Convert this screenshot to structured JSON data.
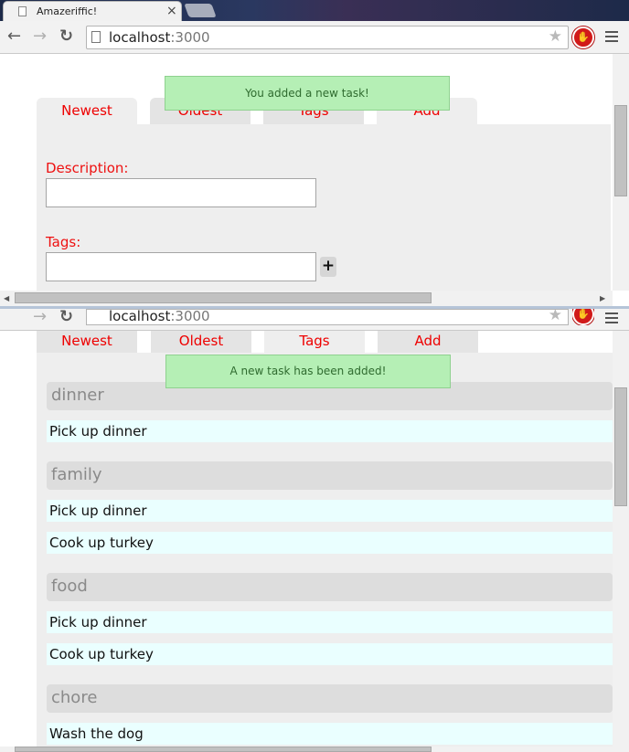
{
  "browser": {
    "tab_title": "Amazeriffic!",
    "tab_close": "×",
    "url_host": "localhost",
    "url_port": ":3000",
    "back_icon": "←",
    "forward_icon": "→",
    "reload_icon": "↻",
    "star_icon": "★",
    "stop_extension_icon": "✋"
  },
  "window1": {
    "tabs": [
      {
        "label": "Newest"
      },
      {
        "label": "Oldest"
      },
      {
        "label": "Tags"
      },
      {
        "label": "Add"
      }
    ],
    "toast": "You added a new task!",
    "form": {
      "description_label": "Description:",
      "description_value": "",
      "tags_label": "Tags:",
      "tags_value": "",
      "add_tag_button": "+"
    }
  },
  "window2": {
    "tabs": [
      {
        "label": "Newest"
      },
      {
        "label": "Oldest"
      },
      {
        "label": "Tags"
      },
      {
        "label": "Add"
      }
    ],
    "toast": "A new task has been added!",
    "groups": [
      {
        "name": "dinner",
        "items": [
          "Pick up dinner"
        ]
      },
      {
        "name": "family",
        "items": [
          "Pick up dinner",
          "Cook up turkey"
        ]
      },
      {
        "name": "food",
        "items": [
          "Pick up dinner",
          "Cook up turkey"
        ]
      },
      {
        "name": "chore",
        "items": [
          "Wash the dog"
        ]
      }
    ]
  },
  "colors": {
    "tab_text": "#ee0000",
    "toast_bg": "#b5efb5",
    "task_bg": "#eaffff",
    "heading_bg": "#dddddd"
  }
}
